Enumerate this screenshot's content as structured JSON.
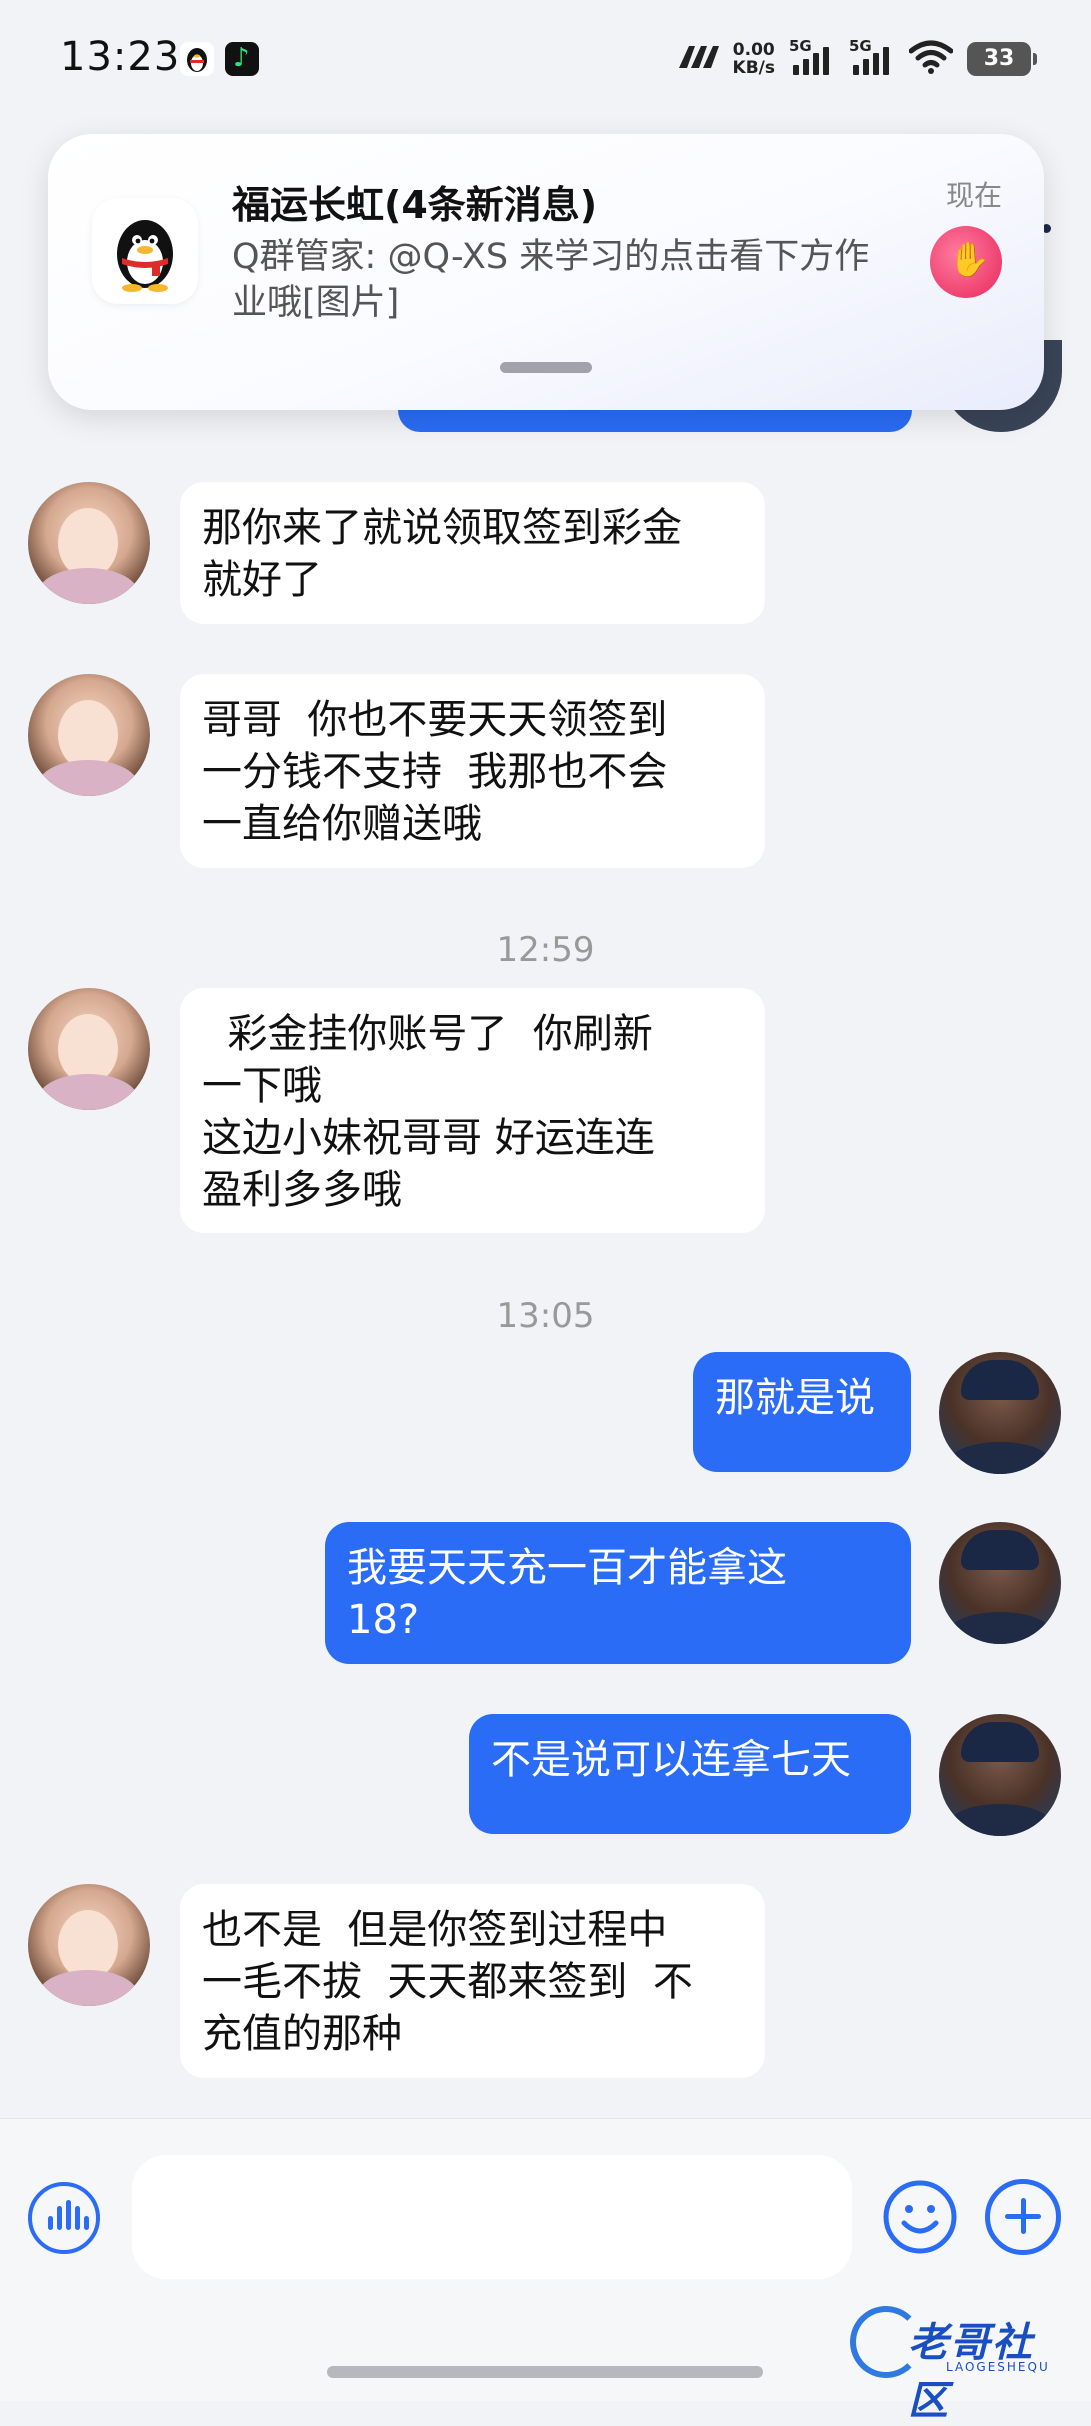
{
  "status_bar": {
    "time": "13:23",
    "net_speed_value": "0.00",
    "net_speed_unit": "KB/s",
    "signal1_label": "5G",
    "signal2_label": "5G",
    "battery": "33",
    "icons": [
      "qq-icon",
      "music-app-icon",
      "hd-icon",
      "signal-icon",
      "signal-icon",
      "wifi-icon",
      "battery-icon"
    ]
  },
  "notification": {
    "title": "福运长虹(4条新消息)",
    "body": "Q群管家: @Q-XS 来学习的点击看下方作业哦[图片]",
    "time": "现在",
    "icon": "qq-penguin-icon"
  },
  "messages": [
    {
      "side": "in",
      "text": "那你来了就说领取签到彩金\n就好了"
    },
    {
      "side": "in",
      "text": "哥哥  你也不要天天领签到\n一分钱不支持  我那也不会\n一直给你赠送哦"
    },
    {
      "type": "time",
      "text": "12:59"
    },
    {
      "side": "in",
      "text": "  彩金挂你账号了  你刷新\n一下哦\n这边小妹祝哥哥 好运连连\n盈利多多哦"
    },
    {
      "type": "time",
      "text": "13:05"
    },
    {
      "side": "out",
      "text": "那就是说"
    },
    {
      "side": "out",
      "text": "我要天天充一百才能拿这\n18?"
    },
    {
      "side": "out",
      "text": "不是说可以连拿七天"
    },
    {
      "side": "in",
      "text": "也不是  但是你签到过程中\n一毛不拔  天天都来签到  不\n充值的那种"
    }
  ],
  "input_bar": {
    "placeholder": "",
    "icons": [
      "voice-icon",
      "emoji-icon",
      "plus-icon"
    ]
  },
  "watermark": {
    "text": "老哥社区",
    "sub": "LAOGESHEQU"
  },
  "colors": {
    "accent": "#2a6cf6",
    "background": "#f2f3f6",
    "incoming_bubble": "#ffffff"
  }
}
